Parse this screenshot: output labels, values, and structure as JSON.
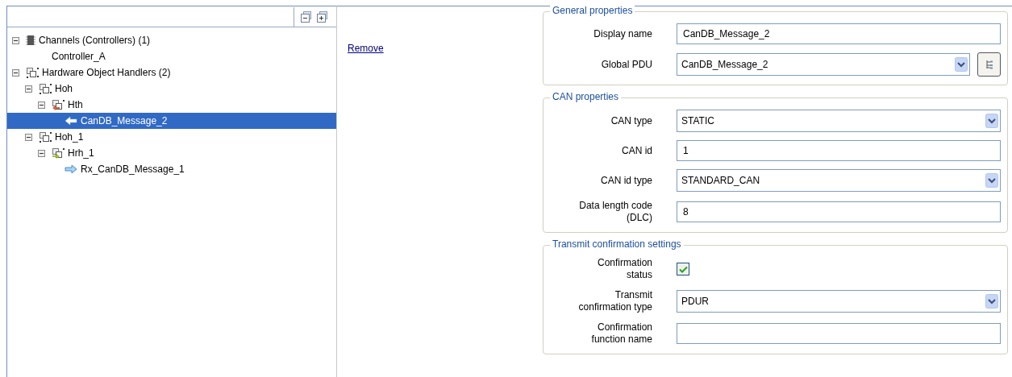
{
  "tree_panel": {
    "toolbar": [
      {
        "kind": "collapse"
      },
      {
        "kind": "expand"
      }
    ],
    "items": [
      {
        "label": "Channels (Controllers) (1)",
        "kind": "chip",
        "expanded": true,
        "selected": false,
        "children": [
          {
            "label": "Controller_A",
            "kind": "plain",
            "selected": false
          }
        ]
      },
      {
        "label": "Hardware Object Handlers (2)",
        "kind": "handler",
        "expanded": true,
        "selected": false,
        "children": [
          {
            "label": "Hoh",
            "kind": "handler",
            "expanded": true,
            "selected": false,
            "children": [
              {
                "label": "Hth",
                "kind": "transmit-handler",
                "expanded": true,
                "selected": false,
                "children": [
                  {
                    "label": "CanDB_Message_2",
                    "kind": "transmit-message",
                    "selected": true
                  }
                ]
              }
            ]
          },
          {
            "label": "Hoh_1",
            "kind": "handler",
            "expanded": true,
            "selected": false,
            "children": [
              {
                "label": "Hrh_1",
                "kind": "receive-handler",
                "expanded": true,
                "selected": false,
                "children": [
                  {
                    "label": "Rx_CanDB_Message_1",
                    "kind": "receive-message",
                    "selected": false
                  }
                ]
              }
            ]
          }
        ]
      }
    ]
  },
  "actions": [
    {
      "label": "Remove"
    }
  ],
  "groups": [
    {
      "title": "General properties",
      "fields": [
        {
          "label": "Display name",
          "kind": "text",
          "value": "CanDB_Message_2"
        },
        {
          "label": "Global PDU",
          "kind": "combo",
          "value": "CanDB_Message_2",
          "browse": true
        }
      ]
    },
    {
      "title": "CAN properties",
      "fields": [
        {
          "label": "CAN type",
          "kind": "combo",
          "value": "STATIC"
        },
        {
          "label": "CAN id",
          "kind": "text",
          "value": "1"
        },
        {
          "label": "CAN id type",
          "kind": "combo",
          "value": "STANDARD_CAN"
        },
        {
          "label": "Data length code (DLC)",
          "kind": "text",
          "value": "8"
        }
      ]
    },
    {
      "title": "Transmit confirmation settings",
      "fields": [
        {
          "label": "Confirmation status",
          "kind": "checkbox",
          "checked": true
        },
        {
          "label": "Transmit confirmation type",
          "kind": "combo",
          "value": "PDUR"
        },
        {
          "label": "Confirmation function name",
          "kind": "text"
        }
      ]
    }
  ]
}
